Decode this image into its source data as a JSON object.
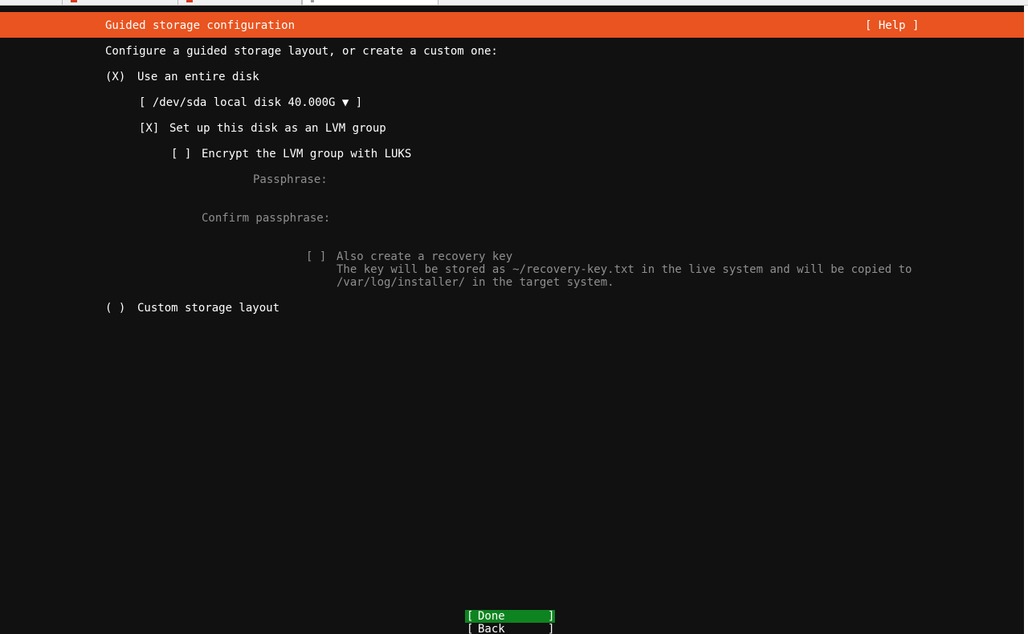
{
  "header": {
    "title": "Guided storage configuration",
    "help_label": "[ Help ]"
  },
  "intro": "Configure a guided storage layout, or create a custom one:",
  "use_entire_disk": {
    "marker": "(X)",
    "label": "Use an entire disk"
  },
  "disk_select": {
    "open": "[",
    "value": "/dev/sda local disk 40.000G",
    "arrow": "▼",
    "close": "]"
  },
  "lvm": {
    "marker": "[X]",
    "label": "Set up this disk as an LVM group"
  },
  "luks": {
    "marker": "[ ]",
    "label": "Encrypt the LVM group with LUKS"
  },
  "passphrase": {
    "label": "Passphrase:",
    "value": ""
  },
  "confirm_passphrase": {
    "label": "Confirm passphrase:",
    "value": ""
  },
  "recovery_key": {
    "marker": "[ ]",
    "label": "Also create a recovery key",
    "help_line1": "The key will be stored as ~/recovery-key.txt in the live system and will be copied to",
    "help_line2": "/var/log/installer/ in the target system."
  },
  "custom_layout": {
    "marker": "( )",
    "label": "Custom storage layout"
  },
  "buttons": {
    "done": {
      "open": "[",
      "label": "Done",
      "close": "]"
    },
    "back": {
      "open": "[",
      "label": "Back",
      "close": "]"
    }
  },
  "colors": {
    "header_bg": "#e95420",
    "focus_bg": "#0e8420",
    "background": "#111111",
    "text": "#ffffff",
    "dim_text": "#8f8f8f"
  }
}
